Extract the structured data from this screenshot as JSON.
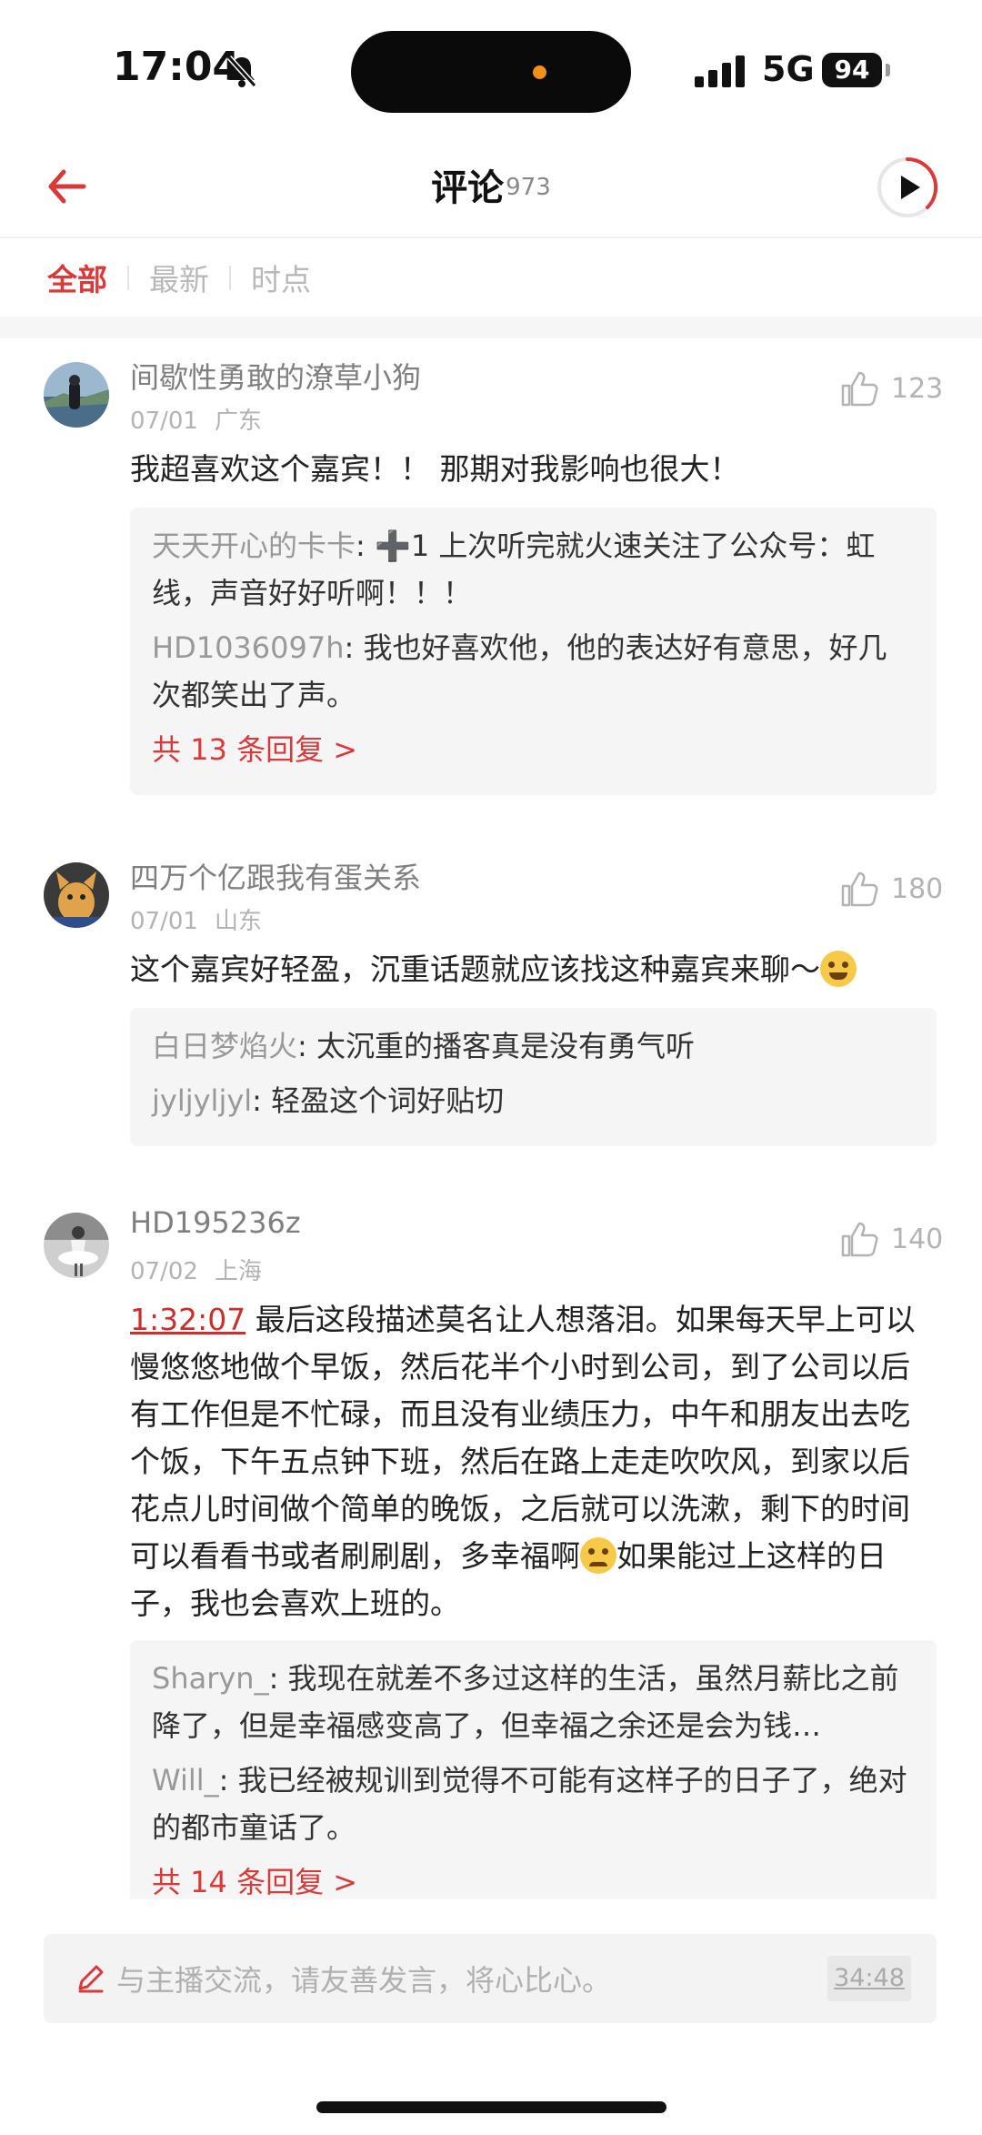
{
  "status_bar": {
    "time": "17:04",
    "network": "5G",
    "battery": "94"
  },
  "header": {
    "title": "评论",
    "count": "973"
  },
  "tabs": [
    {
      "label": "全部",
      "active": true
    },
    {
      "label": "最新",
      "active": false
    },
    {
      "label": "时点",
      "active": false
    }
  ],
  "comments": [
    {
      "user": "间歇性勇敢的潦草小狗",
      "date": "07/01",
      "location": "广东",
      "likes": "123",
      "text": "我超喜欢这个嘉宾！！ 那期对我影响也很大！",
      "replies": [
        {
          "user": "天天开心的卡卡",
          "text": "➕1 上次听完就火速关注了公众号：虹线，声音好好听啊！！！"
        },
        {
          "user": "HD1036097h",
          "text": "我也好喜欢他，他的表达好有意思，好几次都笑出了声。"
        }
      ],
      "more": "共 13 条回复 >"
    },
    {
      "user": "四万个亿跟我有蛋关系",
      "date": "07/01",
      "location": "山东",
      "likes": "180",
      "text": "这个嘉宾好轻盈，沉重话题就应该找这种嘉宾来聊～",
      "replies": [
        {
          "user": "白日梦焰火",
          "text": "太沉重的播客真是没有勇气听"
        },
        {
          "user": "jyljyljyl",
          "text": "轻盈这个词好贴切"
        }
      ]
    },
    {
      "user": "HD195236z",
      "date": "07/02",
      "location": "上海",
      "likes": "140",
      "timestamp": "1:32:07",
      "text_a": " 最后这段描述莫名让人想落泪。如果每天早上可以慢悠悠地做个早饭，然后花半个小时到公司，到了公司以后有工作但是不忙碌，而且没有业绩压力，中午和朋友出去吃个饭，下午五点钟下班，然后在路上走走吹吹风，到家以后花点儿时间做个简单的晚饭，之后就可以洗漱，剩下的时间可以看看书或者刷刷剧，多幸福啊",
      "text_b": "如果能过上这样的日子，我也会喜欢上班的。",
      "replies": [
        {
          "user": "Sharyn_",
          "text": "我现在就差不多过这样的生活，虽然月薪比之前降了，但是幸福感变高了，但幸福之余还是会为钱…"
        },
        {
          "user": "Will_",
          "text": "我已经被规训到觉得不可能有这样子的日子了，绝对的都市童话了。"
        }
      ],
      "more": "共 14 条回复 >"
    }
  ],
  "input": {
    "placeholder": "与主播交流，请友善发言，将心比心。",
    "time": "34:48"
  },
  "colors": {
    "accent": "#d83a3a",
    "muted": "#b3b3b3",
    "reply_bg": "#f5f5f5"
  },
  "icons": {
    "back": "back-arrow-icon",
    "play": "play-icon",
    "like": "thumbs-up-icon",
    "edit": "pen-icon",
    "mute": "bell-slash-icon"
  }
}
